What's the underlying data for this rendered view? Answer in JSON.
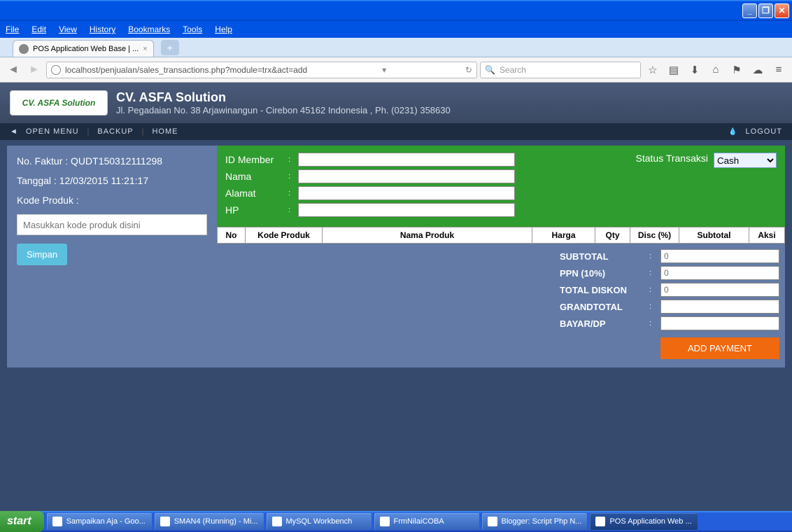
{
  "window": {
    "menus": [
      "File",
      "Edit",
      "View",
      "History",
      "Bookmarks",
      "Tools",
      "Help"
    ]
  },
  "tab": {
    "title": "POS Application Web Base | ...",
    "close": "×",
    "new": "+"
  },
  "urlbar": {
    "url": "localhost/penjualan/sales_transactions.php?module=trx&act=add",
    "search_placeholder": "Search"
  },
  "header": {
    "logo_text": "CV. ASFA Solution",
    "company": "CV. ASFA Solution",
    "address": "Jl. Pegadaian No. 38 Arjawinangun - Cirebon 45162 Indonesia , Ph. (0231) 358630"
  },
  "nav": {
    "open_menu": "OPEN MENU",
    "backup": "BACKUP",
    "home": "HOME",
    "logout": "LOGOUT"
  },
  "left": {
    "faktur_label": "No. Faktur :",
    "faktur_value": "QUDT150312111298",
    "tanggal_label": "Tanggal :",
    "tanggal_value": "12/03/2015 11:21:17",
    "kode_label": "Kode Produk :",
    "kode_placeholder": "Masukkan kode produk disini",
    "simpan": "Simpan"
  },
  "member": {
    "id_label": "ID Member",
    "nama_label": "Nama",
    "alamat_label": "Alamat",
    "hp_label": "HP",
    "status_label": "Status Transaksi",
    "status_value": "Cash"
  },
  "grid": {
    "no": "No",
    "kode": "Kode Produk",
    "nama": "Nama Produk",
    "harga": "Harga",
    "qty": "Qty",
    "disc": "Disc (%)",
    "subtotal": "Subtotal",
    "aksi": "Aksi"
  },
  "totals": {
    "subtotal_label": "SUBTOTAL",
    "subtotal_value": "0",
    "ppn_label": "PPN (10%)",
    "ppn_value": "0",
    "diskon_label": "TOTAL DISKON",
    "diskon_value": "0",
    "grand_label": "GRANDTOTAL",
    "grand_value": "",
    "bayar_label": "BAYAR/DP",
    "bayar_value": "",
    "add_payment": "ADD PAYMENT"
  },
  "taskbar": {
    "start": "start",
    "items": [
      "Sampaikan Aja - Goo...",
      "SMAN4 (Running) - Mi...",
      "MySQL Workbench",
      "FrmNilaiCOBA",
      "Blogger: Script Php N...",
      "POS Application Web ..."
    ]
  }
}
